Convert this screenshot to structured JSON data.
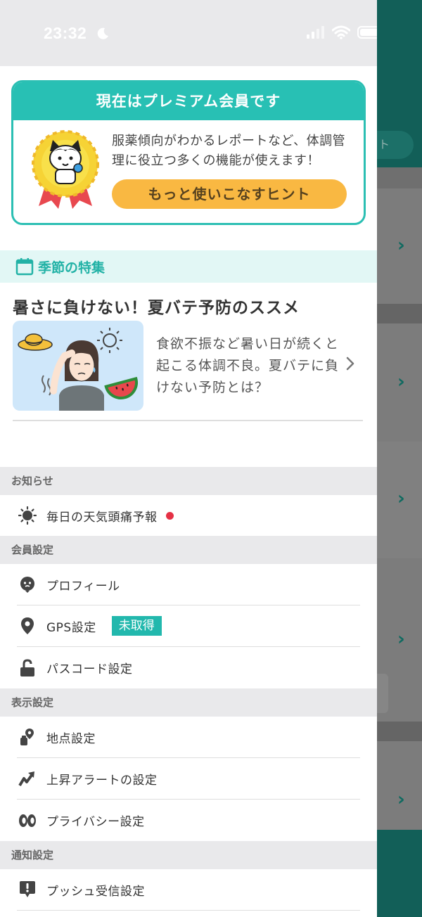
{
  "status_bar": {
    "time": "23:32"
  },
  "premium": {
    "title": "現在はプレミアム会員です",
    "description": "服薬傾向がわかるレポートなど、体調管理に役立つ多くの機能が使えます！",
    "hint_button": "もっと使いこなすヒント"
  },
  "seasonal": {
    "header": "季節の特集",
    "article_title": "暑さに負けない！夏バテ予防のススメ",
    "article_description": "食欲不振など暑い日が続くと起こる体調不良。夏バテに負けない予防とは？"
  },
  "sections": {
    "notice": {
      "header": "お知らせ",
      "items": [
        {
          "label": "毎日の天気頭痛予報",
          "icon": "sun-icon",
          "has_badge": true
        }
      ]
    },
    "member": {
      "header": "会員設定",
      "items": [
        {
          "label": "プロフィール",
          "icon": "face-icon"
        },
        {
          "label": "GPS設定",
          "icon": "location-pin-icon",
          "tag": "未取得"
        },
        {
          "label": "パスコード設定",
          "icon": "unlock-icon"
        }
      ]
    },
    "display": {
      "header": "表示設定",
      "items": [
        {
          "label": "地点設定",
          "icon": "location-settings-icon"
        },
        {
          "label": "上昇アラートの設定",
          "icon": "rising-alert-icon"
        },
        {
          "label": "プライバシー設定",
          "icon": "privacy-eyes-icon"
        }
      ]
    },
    "notification": {
      "header": "通知設定",
      "items": [
        {
          "label": "プッシュ受信設定",
          "icon": "push-notification-icon"
        }
      ]
    }
  },
  "colors": {
    "accent": "#28c0b4",
    "hint_button": "#f9b842",
    "badge_red": "#e53145",
    "app_header": "#125f58"
  }
}
